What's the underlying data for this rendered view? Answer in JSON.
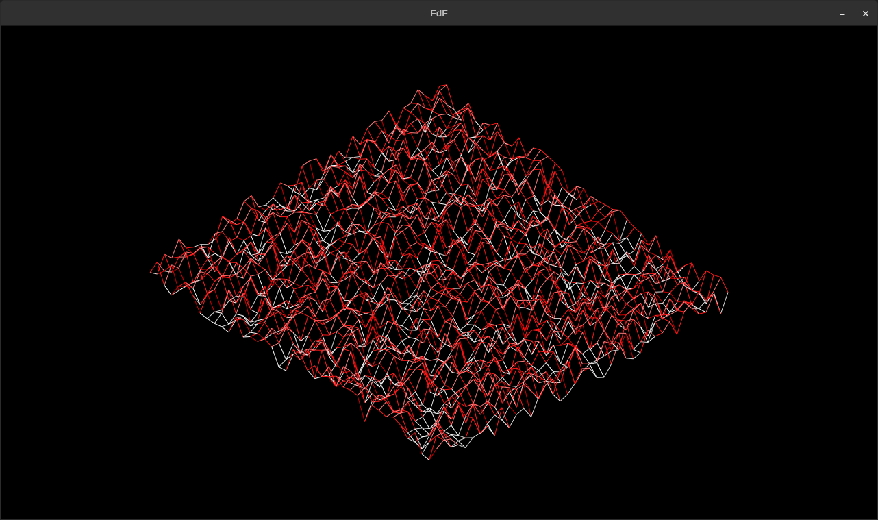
{
  "window": {
    "title": "FdF",
    "minimize_glyph": "–",
    "close_glyph": "✕"
  },
  "render": {
    "background_color": "#000000",
    "line_colors": [
      "#ff1a1a",
      "#ffffff",
      "#cc0000",
      "#ff8080",
      "#dddddd"
    ]
  }
}
